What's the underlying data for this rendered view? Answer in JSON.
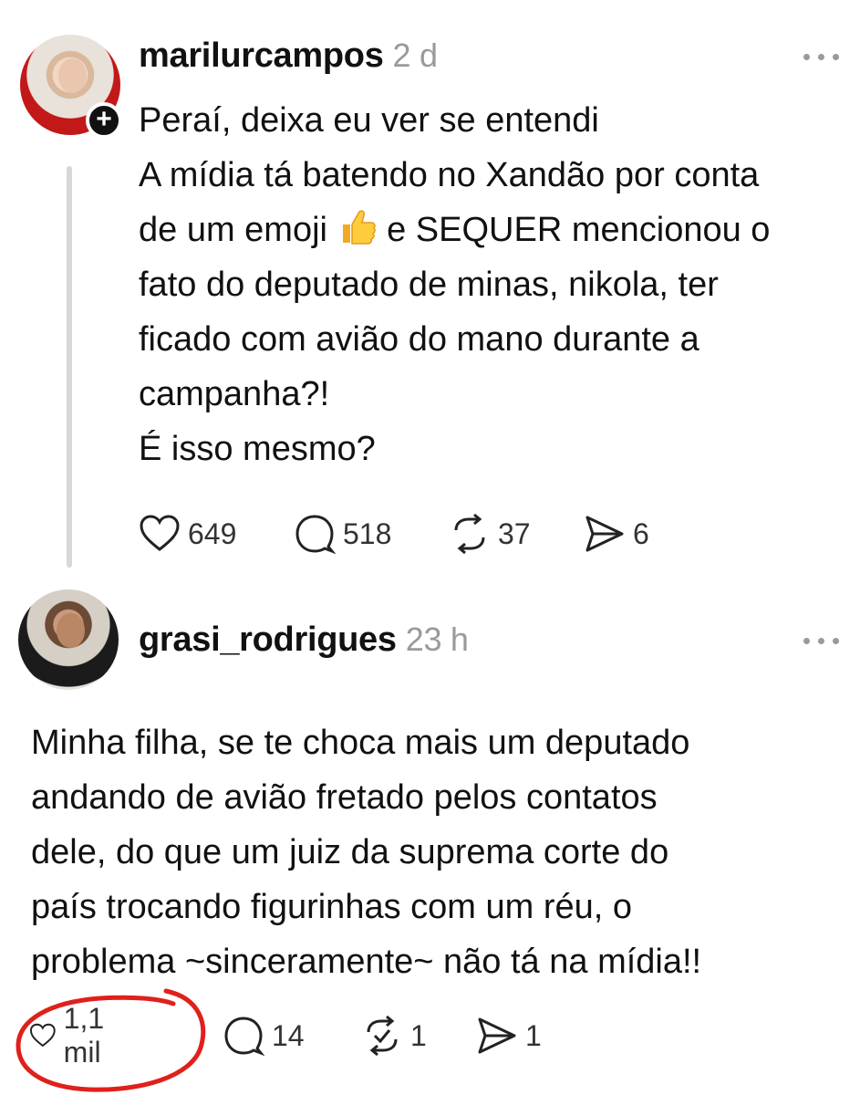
{
  "posts": [
    {
      "username": "marilurcampos",
      "time": "2 d",
      "text_before_emoji": "Peraí, deixa eu ver se entendi\nA mídia tá batendo no Xandão por conta\nde um emoji ",
      "emoji": "thumbs-up",
      "text_after_emoji": " e SEQUER mencionou o\nfato do deputado de minas, nikola, ter\nficado com avião do mano durante a\ncampanha?!\nÉ isso mesmo?",
      "likes": "649",
      "replies": "518",
      "reposts": "37",
      "shares": "6"
    },
    {
      "username": "grasi_rodrigues",
      "time": "23 h",
      "text": "Minha filha, se te choca mais um deputado\nandando de avião fretado pelos contatos\ndele, do que um juiz da suprema corte do\npaís trocando figurinhas com um  réu, o\nproblema ~sinceramente~ não tá na mídia!!",
      "likes": "1,1 mil",
      "replies": "14",
      "reposts": "1",
      "shares": "1"
    }
  ],
  "icons": [
    "heart-icon",
    "comment-icon",
    "repost-icon",
    "share-icon",
    "more-icon",
    "follow-plus-icon"
  ],
  "colors": {
    "annotation": "#e0201b",
    "muted": "#9a9a9a",
    "text": "#111111"
  }
}
